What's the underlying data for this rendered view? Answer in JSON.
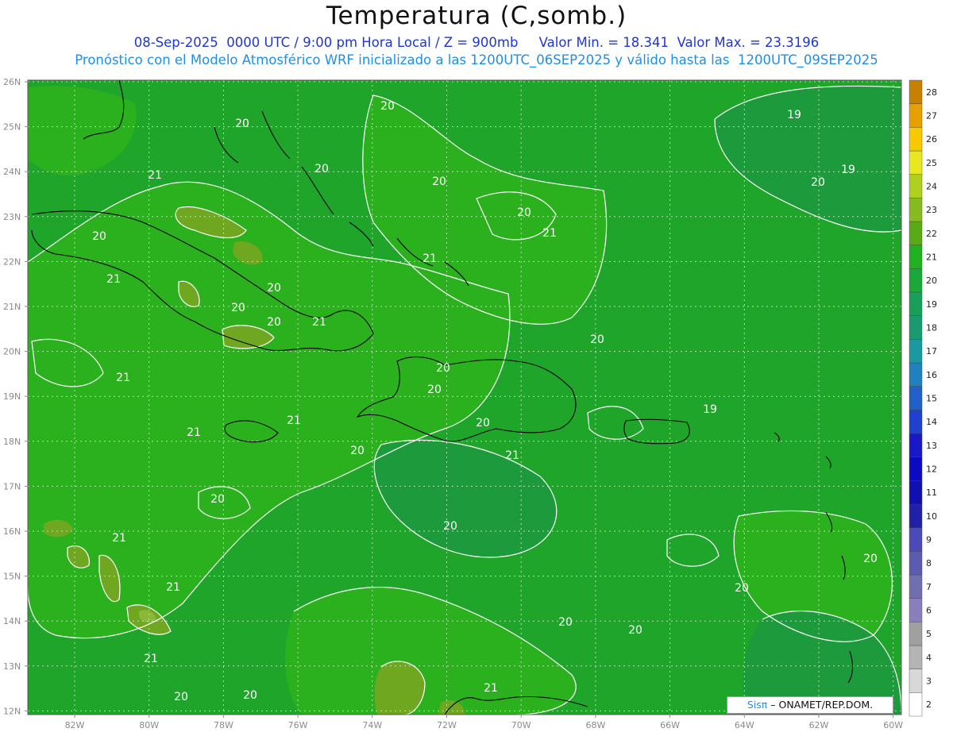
{
  "header": {
    "title": "Temperatura (C,somb.)",
    "line1": "08-Sep-2025  0000 UTC / 9:00 pm Hora Local / Z = 900mb     Valor Min. = 18.341  Valor Max. = 23.3196",
    "line2": "Pronóstico con el Modelo Atmosférico WRF inicializado a las 1200UTC_06SEP2025 y válido hasta las  1200UTC_09SEP2025"
  },
  "map": {
    "lat_labels": [
      "26N",
      "25N",
      "24N",
      "23N",
      "22N",
      "21N",
      "20N",
      "19N",
      "18N",
      "17N",
      "16N",
      "15N",
      "14N",
      "13N",
      "12N"
    ],
    "lon_labels": [
      "82W",
      "80W",
      "78W",
      "76W",
      "74W",
      "72W",
      "70W",
      "68W",
      "66W",
      "64W",
      "62W",
      "60W"
    ],
    "contour_labels": [
      "20",
      "20",
      "20",
      "21",
      "20",
      "20",
      "21",
      "20",
      "21",
      "20",
      "20",
      "20",
      "21",
      "21",
      "21",
      "20",
      "20",
      "20",
      "21",
      "20",
      "21",
      "21",
      "20",
      "20",
      "20",
      "20",
      "19",
      "19",
      "19",
      "20",
      "20",
      "20",
      "20",
      "21",
      "20",
      "20",
      "21",
      "21",
      "21"
    ],
    "colors": {
      "band_19": "#1d9b3c",
      "band_20": "#1ea52a",
      "band_21": "#2ab11d",
      "band_22": "#6fa820",
      "band_23": "#8ab838",
      "contour": "#ffffff",
      "coast": "#000000",
      "grid": "#b8d9b0"
    }
  },
  "colorbar": {
    "levels": [
      "2",
      "3",
      "4",
      "5",
      "6",
      "7",
      "8",
      "9",
      "10",
      "11",
      "12",
      "13",
      "14",
      "15",
      "16",
      "17",
      "18",
      "19",
      "20",
      "21",
      "22",
      "23",
      "24",
      "25",
      "26",
      "27",
      "28"
    ],
    "colors": [
      "#ffffff",
      "#d8d8d8",
      "#b4b4b4",
      "#a0a0a0",
      "#8a7fb8",
      "#7070b0",
      "#5b5bb0",
      "#4a4ab8",
      "#2020a8",
      "#1010b0",
      "#0a0ac0",
      "#1818c8",
      "#2040d0",
      "#2060c8",
      "#2080c0",
      "#1a9aa0",
      "#1a9a70",
      "#18a058",
      "#1aa83a",
      "#20b020",
      "#5aaa18",
      "#88bb20",
      "#b0d020",
      "#e8e820",
      "#f8c800",
      "#e8a000",
      "#c88000"
    ]
  },
  "credit": {
    "brand": "Sisπ",
    "text": "– ONAMET/REP.DOM."
  }
}
